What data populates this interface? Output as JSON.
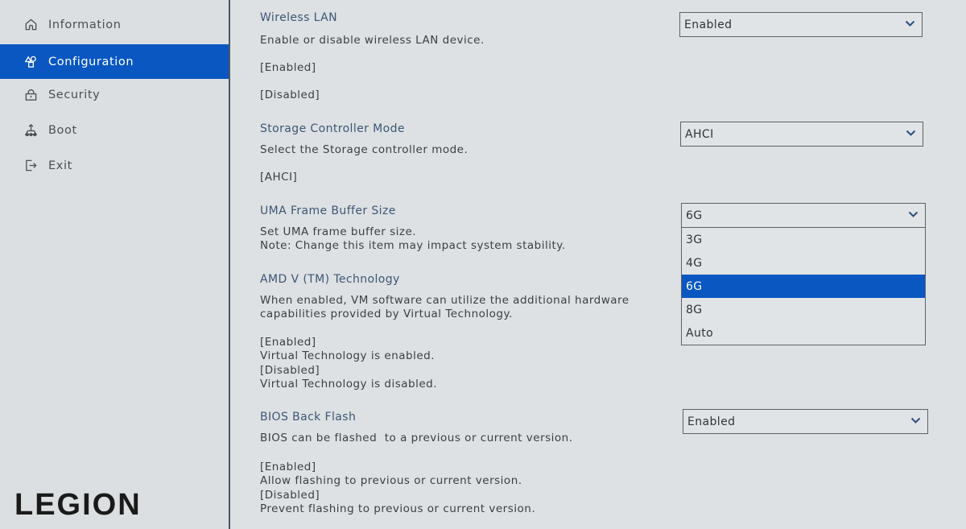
{
  "sidebar": {
    "items": [
      {
        "label": "Information",
        "icon": "home-icon",
        "active": false
      },
      {
        "label": "Configuration",
        "icon": "configuration-icon",
        "active": true
      },
      {
        "label": "Security",
        "icon": "lock-icon",
        "active": false
      },
      {
        "label": "Boot",
        "icon": "boot-icon",
        "active": false
      },
      {
        "label": "Exit",
        "icon": "exit-icon",
        "active": false
      }
    ],
    "logo": "LEGION"
  },
  "colors": {
    "accent": "#0a57c2",
    "title_text": "#3d5675",
    "background": "#dde1e3",
    "divider": "#4a5666"
  },
  "settings": {
    "wireless_lan": {
      "title": "Wireless LAN",
      "description": "Enable or disable wireless LAN device.",
      "option_enabled": "[Enabled]",
      "option_disabled": "[Disabled]",
      "value": "Enabled"
    },
    "storage_controller": {
      "title": "Storage Controller Mode",
      "description": "Select the Storage controller mode.",
      "option_ahci": "[AHCI]",
      "value": "AHCI"
    },
    "uma_frame_buffer": {
      "title": "UMA Frame Buffer Size",
      "description_line1": "Set UMA frame buffer size.",
      "description_line2": "Note: Change this item may impact system stability.",
      "value": "6G",
      "dropdown_open": true,
      "options": [
        "3G",
        "4G",
        "6G",
        "8G",
        "Auto"
      ],
      "selected_option": "6G"
    },
    "amd_v": {
      "title": "AMD V (TM) Technology",
      "description_line1": "When enabled, VM software can utilize the additional hardware",
      "description_line2": "capabilities provided by Virtual Technology.",
      "option_enabled": "[Enabled]",
      "enabled_desc": "Virtual Technology is enabled.",
      "option_disabled": "[Disabled]",
      "disabled_desc": "Virtual Technology is disabled."
    },
    "bios_back_flash": {
      "title": "BIOS Back Flash",
      "description": "BIOS can be flashed  to a previous or current version.",
      "option_enabled": "[Enabled]",
      "enabled_desc": "Allow flashing to previous or current version.",
      "option_disabled": "[Disabled]",
      "disabled_desc": "Prevent flashing to previous or current version.",
      "value": "Enabled"
    }
  }
}
